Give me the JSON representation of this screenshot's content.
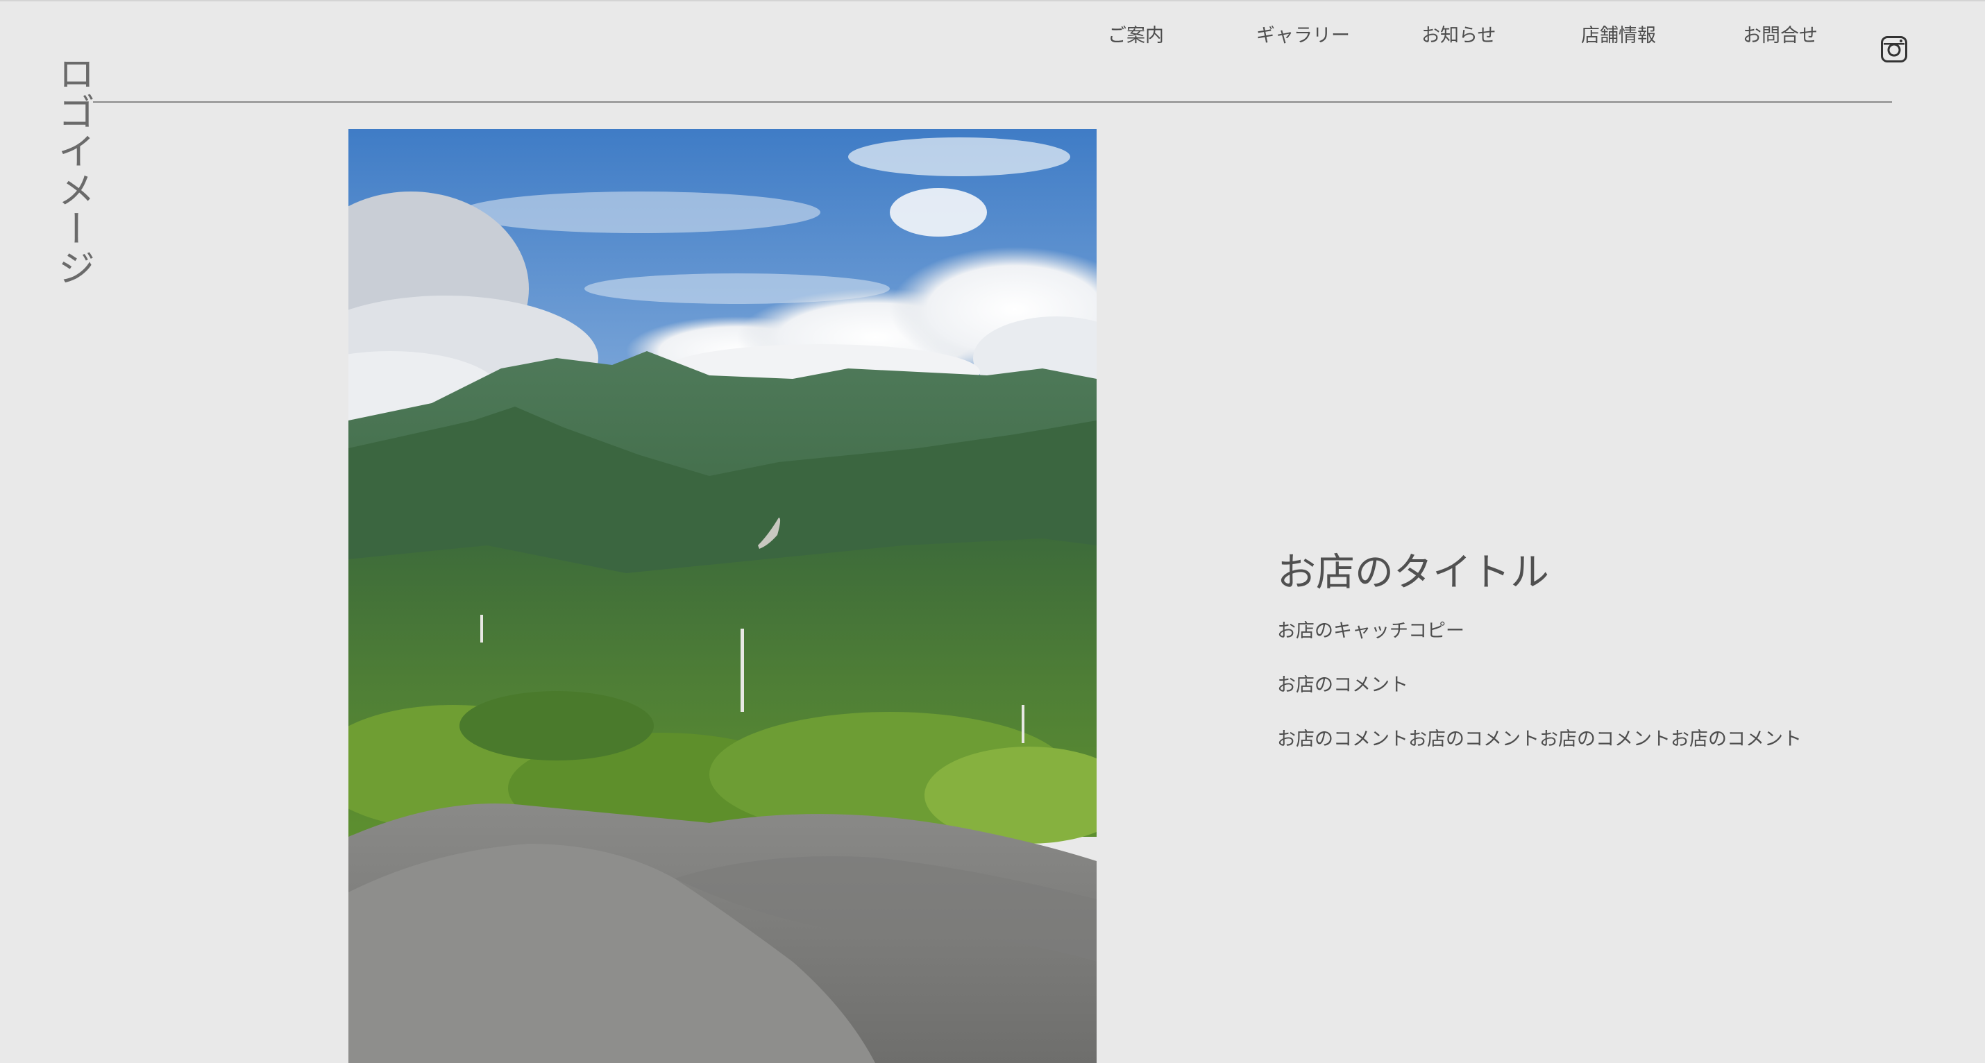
{
  "logo": {
    "text": "ロゴイメージ"
  },
  "nav": {
    "items": [
      {
        "label": "ご案内"
      },
      {
        "label": "ギャラリー"
      },
      {
        "label": "お知らせ"
      },
      {
        "label": "店舗情報"
      },
      {
        "label": "お問合せ"
      }
    ],
    "instagram_icon": "instagram-icon"
  },
  "hero": {
    "image_description": "mountain-landscape-photo"
  },
  "shop": {
    "title": "お店のタイトル",
    "catchcopy": "お店のキャッチコピー",
    "comment": "お店のコメント",
    "comment_long": "お店のコメントお店のコメントお店のコメントお店のコメント"
  },
  "colors": {
    "background": "#e9e9e9",
    "text": "#4d4d4d",
    "rule": "#8a8a8a"
  }
}
